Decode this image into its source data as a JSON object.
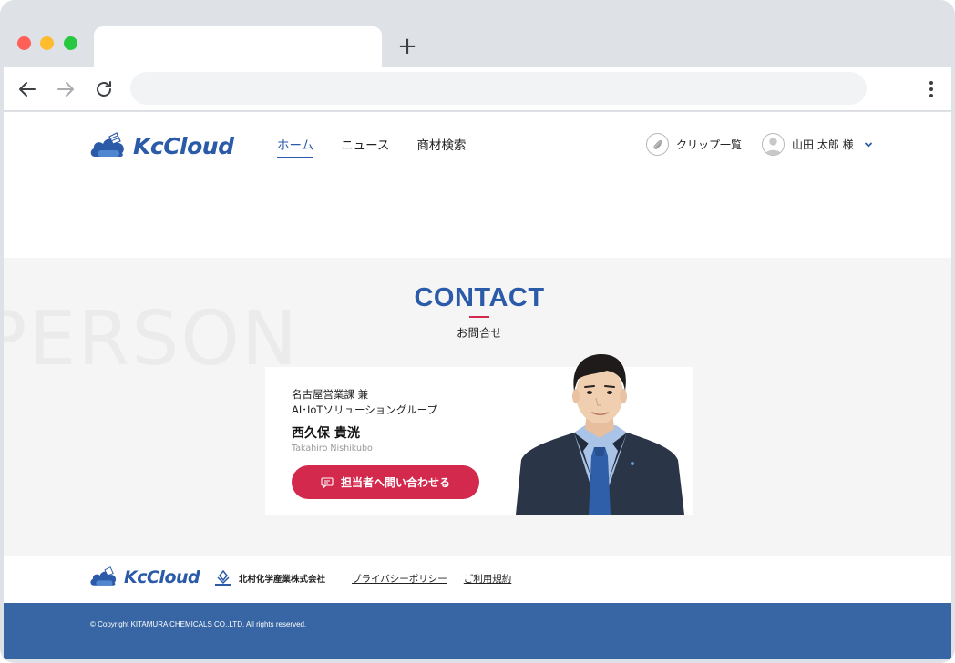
{
  "browser": {
    "new_tab_label": "+",
    "url": ""
  },
  "site": {
    "logo_text": "KcCloud",
    "nav": [
      "ホーム",
      "ニュース",
      "商材検索"
    ],
    "clip_label": "クリップ一覧",
    "user_label": "山田 太郎 様"
  },
  "contact": {
    "bg_word": "PERSON",
    "title": "CONTACT",
    "subtitle": "お問合せ",
    "dept_line1": "名古屋営業課 兼",
    "dept_line2": "AI･IoTソリューショングループ",
    "name": "西久保 貴洸",
    "name_roman": "Takahiro Nishikubo",
    "button_label": "担当者へ問い合わせる"
  },
  "footer": {
    "logo_text": "KcCloud",
    "company": "北村化学産業株式会社",
    "links": [
      "プライバシーポリシー",
      "ご利用規約"
    ],
    "copyright": "© Copyright KITAMURA CHEMICALS CO.,LTD. All rights reserved."
  },
  "colors": {
    "brand_blue": "#2a5aa8",
    "accent_red": "#d3294d",
    "footer_blue": "#3866a4"
  }
}
